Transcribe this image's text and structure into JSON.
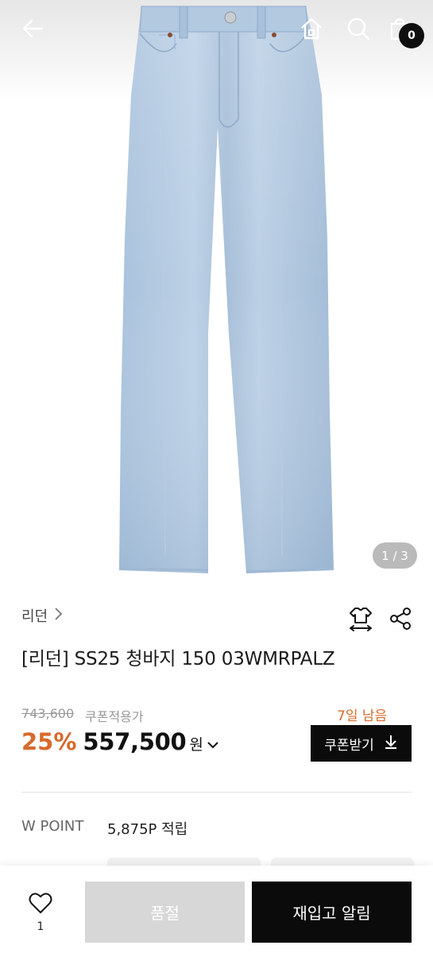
{
  "header": {
    "cart_count": "0"
  },
  "gallery": {
    "counter": "1 / 3"
  },
  "product": {
    "brand": "리던",
    "title": "[리던] SS25 청바지 150 03WMRPALZ",
    "original_price": "743,600",
    "coupon_note": "쿠폰적용가",
    "days_left": "7일 남음",
    "discount": "25%",
    "price": "557,500",
    "currency": "원",
    "coupon_button": "쿠폰받기"
  },
  "points": {
    "label": "W POINT",
    "value": "5,875P 적립"
  },
  "bottom_bar": {
    "wish_count": "1",
    "soldout_label": "품절",
    "restock_label": "재입고 알림"
  },
  "colors": {
    "accent": "#d8692a",
    "primary_button": "#0b0b0b",
    "disabled_button": "#d7d7d7"
  }
}
